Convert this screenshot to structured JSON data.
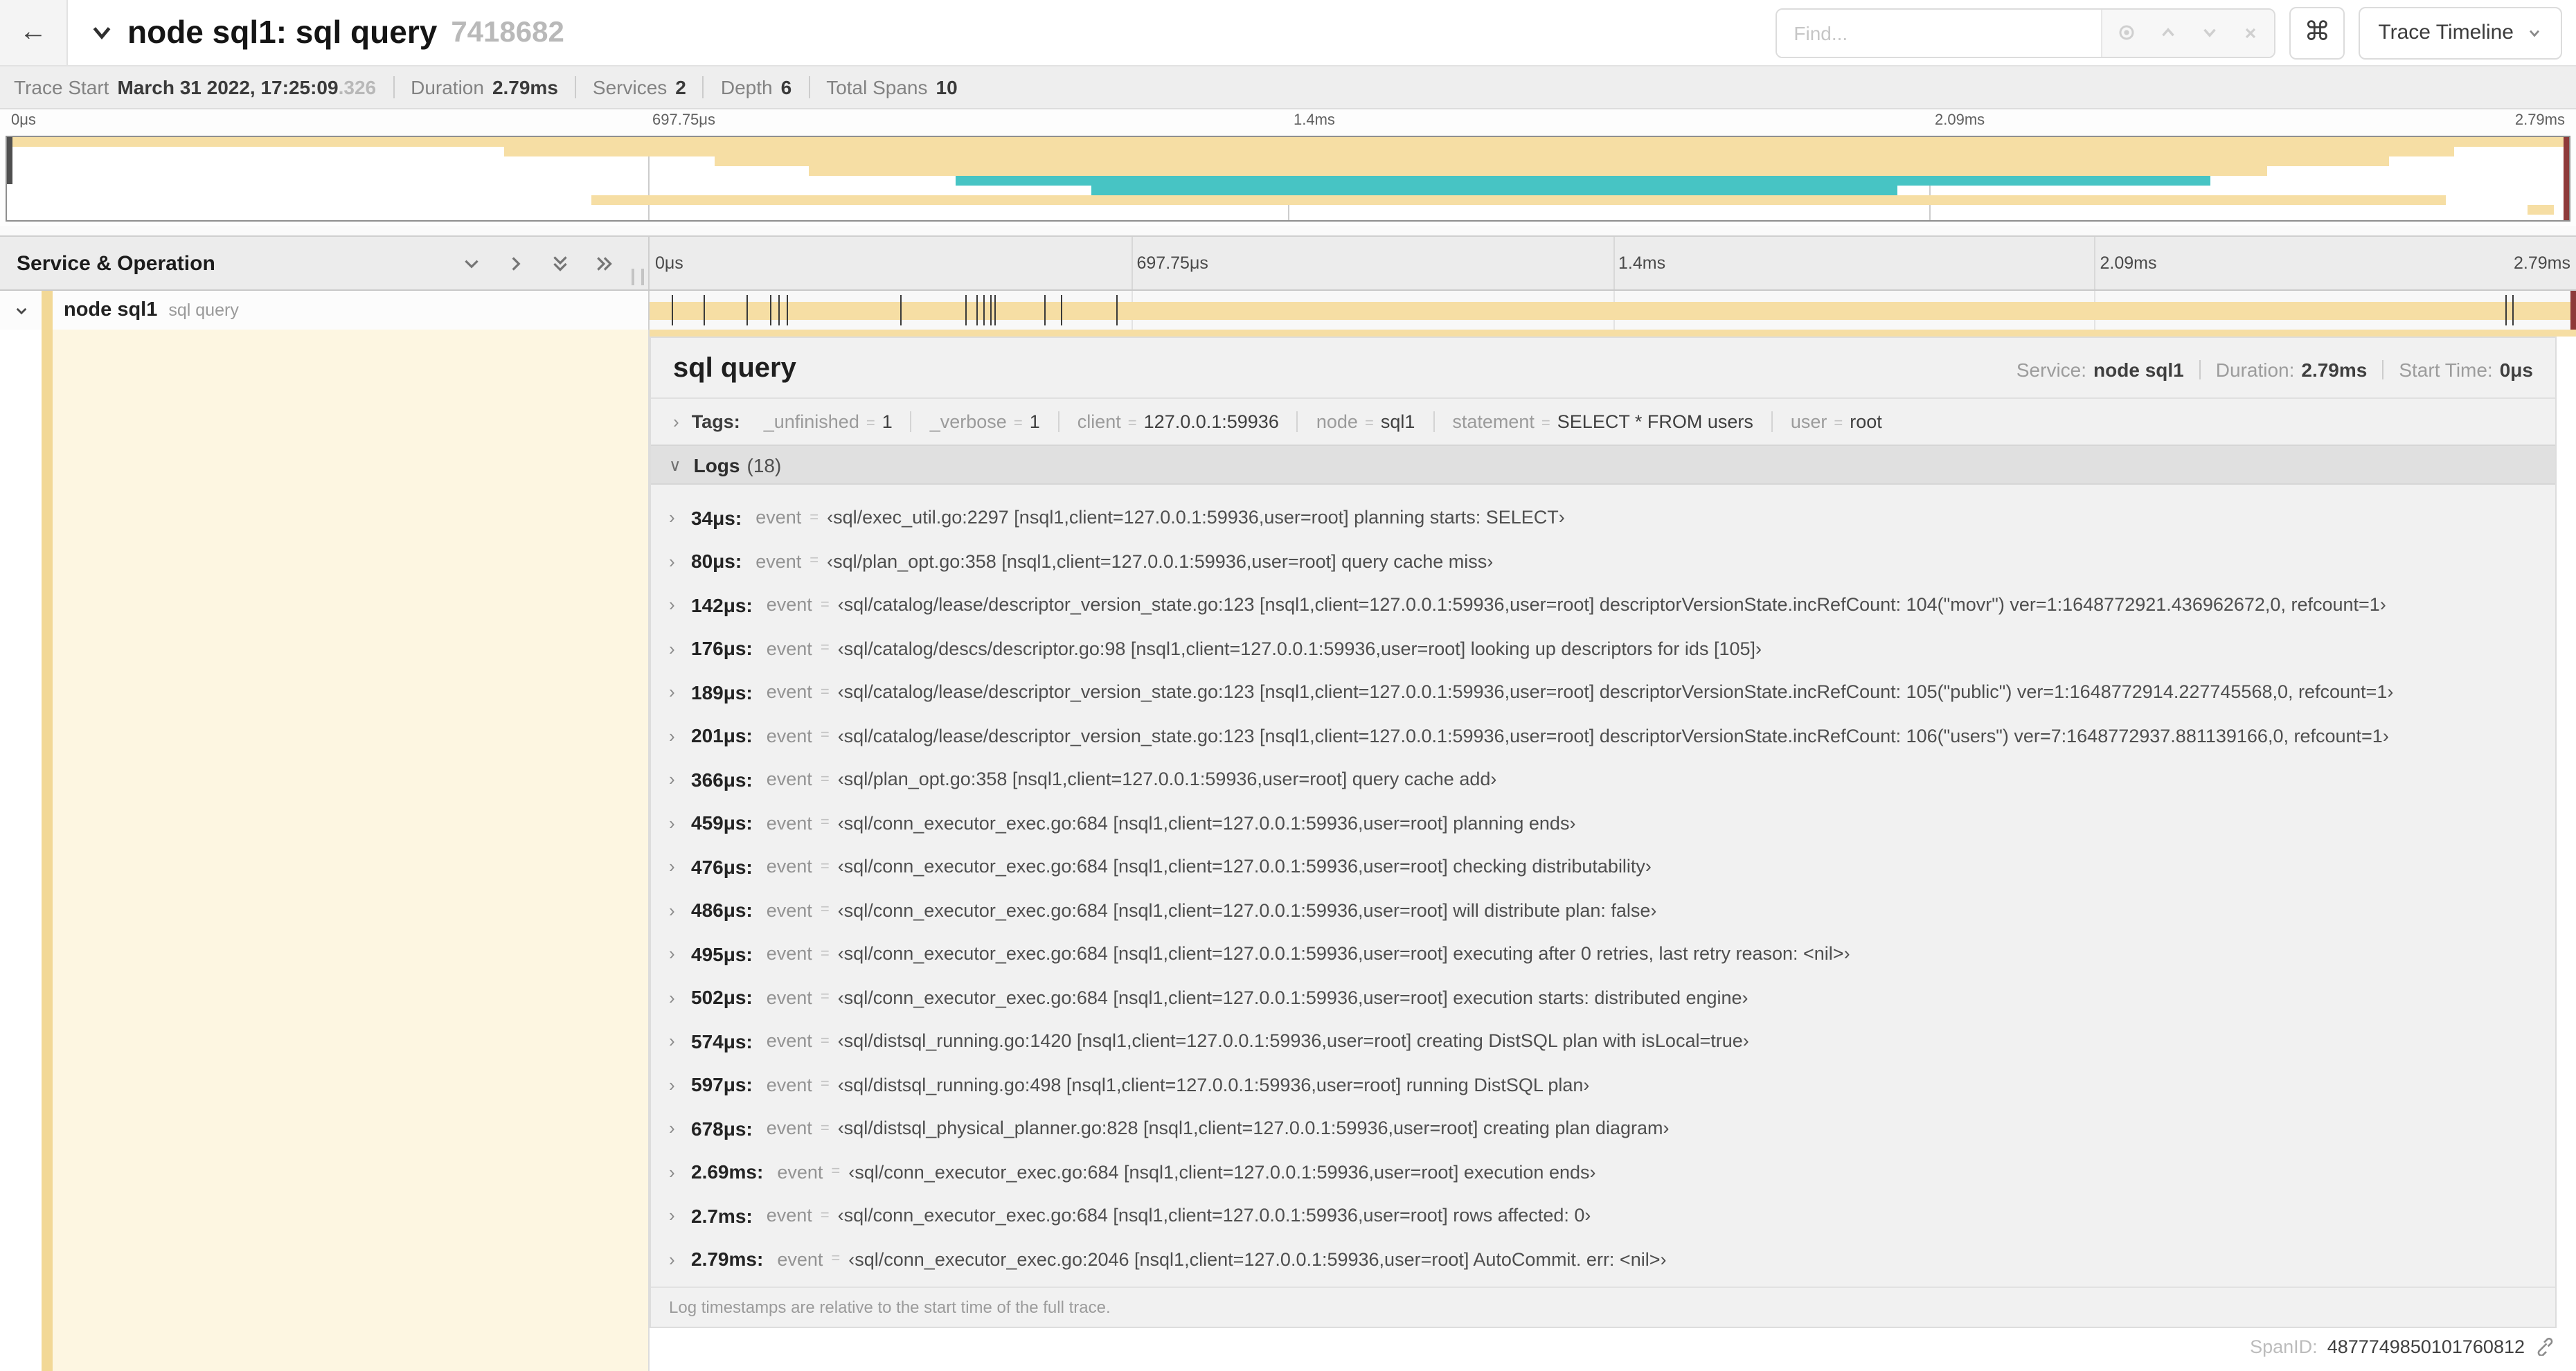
{
  "ui": {
    "back": "←",
    "cmd": "⌘",
    "eq": "=",
    "chev_right": "›",
    "chev_down": "∨"
  },
  "colors": {
    "span_tan": "#F6DEA4",
    "span_teal": "#47C4C4",
    "guide_red": "#8E3A3A",
    "selected_row_cream": "#FDF6E1"
  },
  "header": {
    "title": "node sql1: sql query",
    "trace_id": "7418682",
    "find_placeholder": "Find...",
    "view_select_label": "Trace Timeline"
  },
  "summary": {
    "items": [
      {
        "label": "Trace Start",
        "value": "March 31 2022, 17:25:09",
        "suffix": ".326"
      },
      {
        "label": "Duration",
        "value": "2.79ms"
      },
      {
        "label": "Services",
        "value": "2"
      },
      {
        "label": "Depth",
        "value": "6"
      },
      {
        "label": "Total Spans",
        "value": "10"
      }
    ]
  },
  "trace": {
    "duration_us": 2790
  },
  "ruler_labels": [
    {
      "text": "0μs",
      "pct": 0,
      "align": "left"
    },
    {
      "text": "697.75μs",
      "pct": 25,
      "align": "left"
    },
    {
      "text": "1.4ms",
      "pct": 50,
      "align": "left"
    },
    {
      "text": "2.09ms",
      "pct": 75,
      "align": "left"
    },
    {
      "text": "2.79ms",
      "pct": 100,
      "align": "right"
    }
  ],
  "minimap": {
    "spans": [
      {
        "row": 1,
        "start": 0,
        "end": 100,
        "color": "span_tan"
      },
      {
        "row": 2,
        "start": 19.4,
        "end": 95.5,
        "color": "span_tan"
      },
      {
        "row": 3,
        "start": 27.6,
        "end": 93,
        "color": "span_tan"
      },
      {
        "row": 4,
        "start": 31.3,
        "end": 88.2,
        "color": "span_tan"
      },
      {
        "row": 5,
        "start": 37,
        "end": 86,
        "color": "span_teal"
      },
      {
        "row": 6,
        "start": 42.3,
        "end": 73.8,
        "color": "span_teal"
      },
      {
        "row": 7,
        "start": 22.8,
        "end": 95.2,
        "color": "span_tan"
      },
      {
        "row": 8,
        "start": 98.4,
        "end": 99.4,
        "color": "span_tan"
      }
    ]
  },
  "timeline": {
    "left_header": "Service & Operation",
    "span": {
      "service": "node sql1",
      "operation": "sql query"
    }
  },
  "detail": {
    "title": "sql query",
    "service_label": "Service:",
    "service": "node sql1",
    "duration_label": "Duration:",
    "duration": "2.79ms",
    "start_label": "Start Time:",
    "start": "0μs",
    "tags_label": "Tags:",
    "tags": [
      {
        "key": "_unfinished",
        "value": "1"
      },
      {
        "key": "_verbose",
        "value": "1"
      },
      {
        "key": "client",
        "value": "127.0.0.1:59936"
      },
      {
        "key": "node",
        "value": "sql1"
      },
      {
        "key": "statement",
        "value": "SELECT * FROM users"
      },
      {
        "key": "user",
        "value": "root"
      }
    ],
    "logs_label": "Logs",
    "logs_count": "(18)",
    "logs": [
      {
        "time": "34μs:",
        "t": 34,
        "field": "event",
        "value": "‹sql/exec_util.go:2297 [nsql1,client=127.0.0.1:59936,user=root] planning starts: SELECT›"
      },
      {
        "time": "80μs:",
        "t": 80,
        "field": "event",
        "value": "‹sql/plan_opt.go:358 [nsql1,client=127.0.0.1:59936,user=root] query cache miss›"
      },
      {
        "time": "142μs:",
        "t": 142,
        "field": "event",
        "value": "‹sql/catalog/lease/descriptor_version_state.go:123 [nsql1,client=127.0.0.1:59936,user=root] descriptorVersionState.incRefCount: 104(\"movr\") ver=1:1648772921.436962672,0, refcount=1›"
      },
      {
        "time": "176μs:",
        "t": 176,
        "field": "event",
        "value": "‹sql/catalog/descs/descriptor.go:98 [nsql1,client=127.0.0.1:59936,user=root] looking up descriptors for ids [105]›"
      },
      {
        "time": "189μs:",
        "t": 189,
        "field": "event",
        "value": "‹sql/catalog/lease/descriptor_version_state.go:123 [nsql1,client=127.0.0.1:59936,user=root] descriptorVersionState.incRefCount: 105(\"public\") ver=1:1648772914.227745568,0, refcount=1›"
      },
      {
        "time": "201μs:",
        "t": 201,
        "field": "event",
        "value": "‹sql/catalog/lease/descriptor_version_state.go:123 [nsql1,client=127.0.0.1:59936,user=root] descriptorVersionState.incRefCount: 106(\"users\") ver=7:1648772937.881139166,0, refcount=1›"
      },
      {
        "time": "366μs:",
        "t": 366,
        "field": "event",
        "value": "‹sql/plan_opt.go:358 [nsql1,client=127.0.0.1:59936,user=root] query cache add›"
      },
      {
        "time": "459μs:",
        "t": 459,
        "field": "event",
        "value": "‹sql/conn_executor_exec.go:684 [nsql1,client=127.0.0.1:59936,user=root] planning ends›"
      },
      {
        "time": "476μs:",
        "t": 476,
        "field": "event",
        "value": "‹sql/conn_executor_exec.go:684 [nsql1,client=127.0.0.1:59936,user=root] checking distributability›"
      },
      {
        "time": "486μs:",
        "t": 486,
        "field": "event",
        "value": "‹sql/conn_executor_exec.go:684 [nsql1,client=127.0.0.1:59936,user=root] will distribute plan: false›"
      },
      {
        "time": "495μs:",
        "t": 495,
        "field": "event",
        "value": "‹sql/conn_executor_exec.go:684 [nsql1,client=127.0.0.1:59936,user=root] executing after 0 retries, last retry reason: <nil>›"
      },
      {
        "time": "502μs:",
        "t": 502,
        "field": "event",
        "value": "‹sql/conn_executor_exec.go:684 [nsql1,client=127.0.0.1:59936,user=root] execution starts: distributed engine›"
      },
      {
        "time": "574μs:",
        "t": 574,
        "field": "event",
        "value": "‹sql/distsql_running.go:1420 [nsql1,client=127.0.0.1:59936,user=root] creating DistSQL plan with isLocal=true›"
      },
      {
        "time": "597μs:",
        "t": 597,
        "field": "event",
        "value": "‹sql/distsql_running.go:498 [nsql1,client=127.0.0.1:59936,user=root] running DistSQL plan›"
      },
      {
        "time": "678μs:",
        "t": 678,
        "field": "event",
        "value": "‹sql/distsql_physical_planner.go:828 [nsql1,client=127.0.0.1:59936,user=root] creating plan diagram›"
      },
      {
        "time": "2.69ms:",
        "t": 2690,
        "field": "event",
        "value": "‹sql/conn_executor_exec.go:684 [nsql1,client=127.0.0.1:59936,user=root] execution ends›"
      },
      {
        "time": "2.7ms:",
        "t": 2700,
        "field": "event",
        "value": "‹sql/conn_executor_exec.go:684 [nsql1,client=127.0.0.1:59936,user=root] rows affected: 0›"
      },
      {
        "time": "2.79ms:",
        "t": 2790,
        "field": "event",
        "value": "‹sql/conn_executor_exec.go:2046 [nsql1,client=127.0.0.1:59936,user=root] AutoCommit. err: <nil>›"
      }
    ],
    "footer": "Log timestamps are relative to the start time of the full trace.",
    "span_id_label": "SpanID:",
    "span_id": "4877749850101760812"
  }
}
